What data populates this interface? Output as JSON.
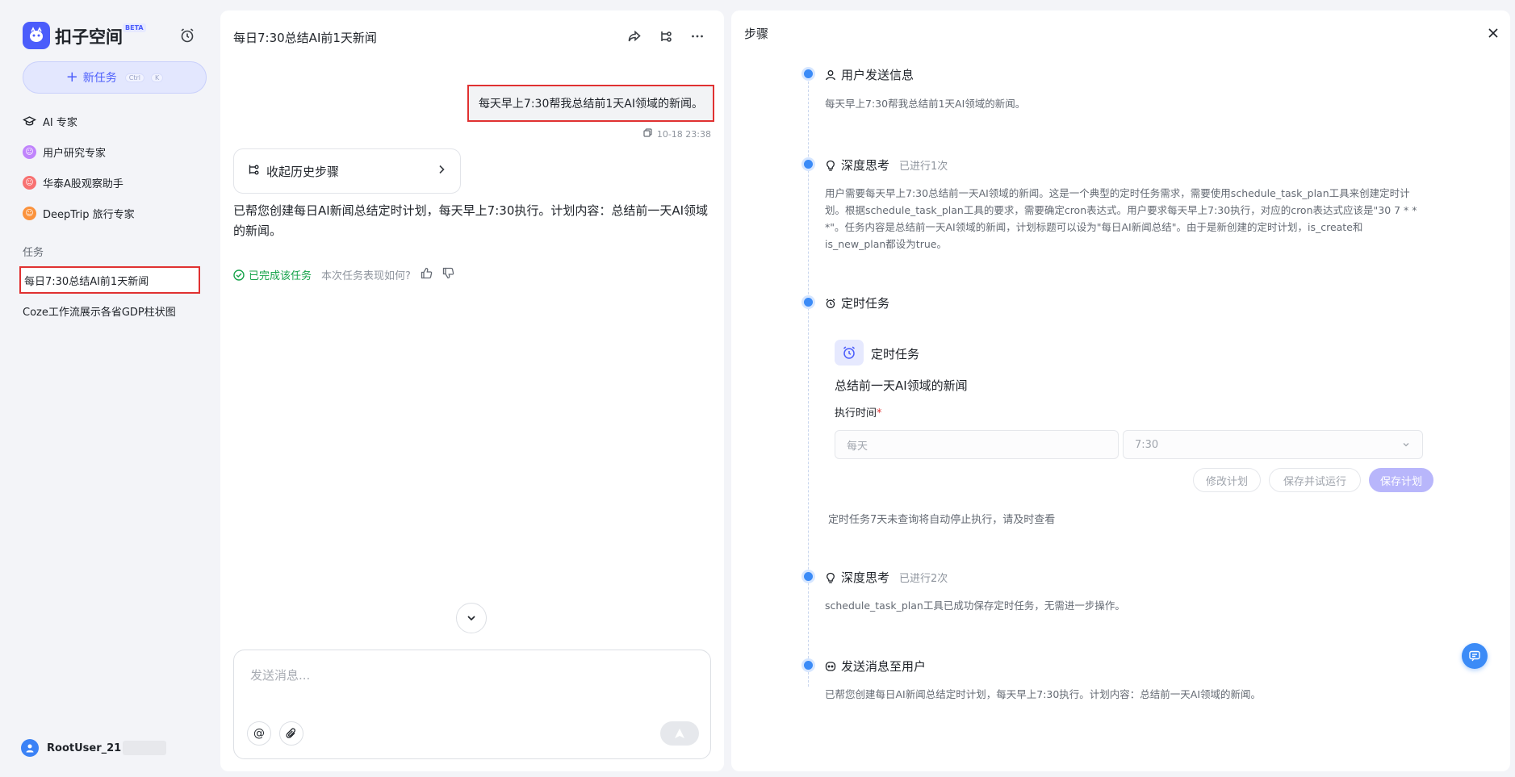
{
  "sidebar": {
    "brand": "扣子空间",
    "beta_badge": "BETA",
    "new_task": {
      "label": "新任务",
      "shortcut_1": "Ctrl",
      "shortcut_2": "K"
    },
    "agents": [
      {
        "label": "AI 专家",
        "icon": "graduation-cap-icon"
      },
      {
        "label": "用户研究专家",
        "icon": "user-research-icon",
        "color": "#a855f7"
      },
      {
        "label": "华泰A股观察助手",
        "icon": "stock-icon",
        "color": "#ef4444"
      },
      {
        "label": "DeepTrip 旅行专家",
        "icon": "travel-icon",
        "color": "#f97316"
      }
    ],
    "tasks_label": "任务",
    "tasks": [
      {
        "label": "每日7:30总结AI前1天新闻"
      },
      {
        "label": "Coze工作流展示各省GDP柱状图"
      }
    ],
    "user": {
      "name": "RootUser_21"
    }
  },
  "chat": {
    "title": "每日7:30总结AI前1天新闻",
    "user_message": "每天早上7:30帮我总结前1天AI领域的新闻。",
    "timestamp": "10-18 23:38",
    "history_card": "收起历史步骤",
    "reply": "已帮您创建每日AI新闻总结定时计划，每天早上7:30执行。计划内容：总结前一天AI领域的新闻。",
    "done_label": "已完成该任务",
    "rate_question": "本次任务表现如何?",
    "composer_placeholder": "发送消息..."
  },
  "steps": {
    "title": "步骤",
    "items": [
      {
        "heading": "用户发送信息",
        "body": "每天早上7:30帮我总结前1天AI领域的新闻。"
      },
      {
        "heading": "深度思考",
        "sub": "已进行1次",
        "body": "用户需要每天早上7:30总结前一天AI领域的新闻。这是一个典型的定时任务需求，需要使用schedule_task_plan工具来创建定时计划。根据schedule_task_plan工具的要求，需要确定cron表达式。用户要求每天早上7:30执行，对应的cron表达式应该是\"30 7 * * *\"。任务内容是总结前一天AI领域的新闻，计划标题可以设为\"每日AI新闻总结\"。由于是新创建的定时计划，is_create和is_new_plan都设为true。"
      },
      {
        "heading": "定时任务"
      },
      {
        "heading": "深度思考",
        "sub": "已进行2次",
        "body": "schedule_task_plan工具已成功保存定时任务，无需进一步操作。"
      },
      {
        "heading": "发送消息至用户",
        "body": "已帮您创建每日AI新闻总结定时计划，每天早上7:30执行。计划内容：总结前一天AI领域的新闻。"
      }
    ],
    "task_card": {
      "title": "定时任务",
      "description": "总结前一天AI领域的新闻",
      "exec_label": "执行时间",
      "required_mark": "*",
      "frequency": "每天",
      "time": "7:30",
      "btn_modify": "修改计划",
      "btn_save_run": "保存并试运行",
      "btn_save": "保存计划"
    },
    "warning": "定时任务7天未查询将自动停止执行，请及时查看"
  },
  "colors": {
    "accent": "#4b5dfb",
    "highlight_border": "#e03131",
    "success": "#16a34a",
    "timeline_dot": "#3b8bf7"
  }
}
